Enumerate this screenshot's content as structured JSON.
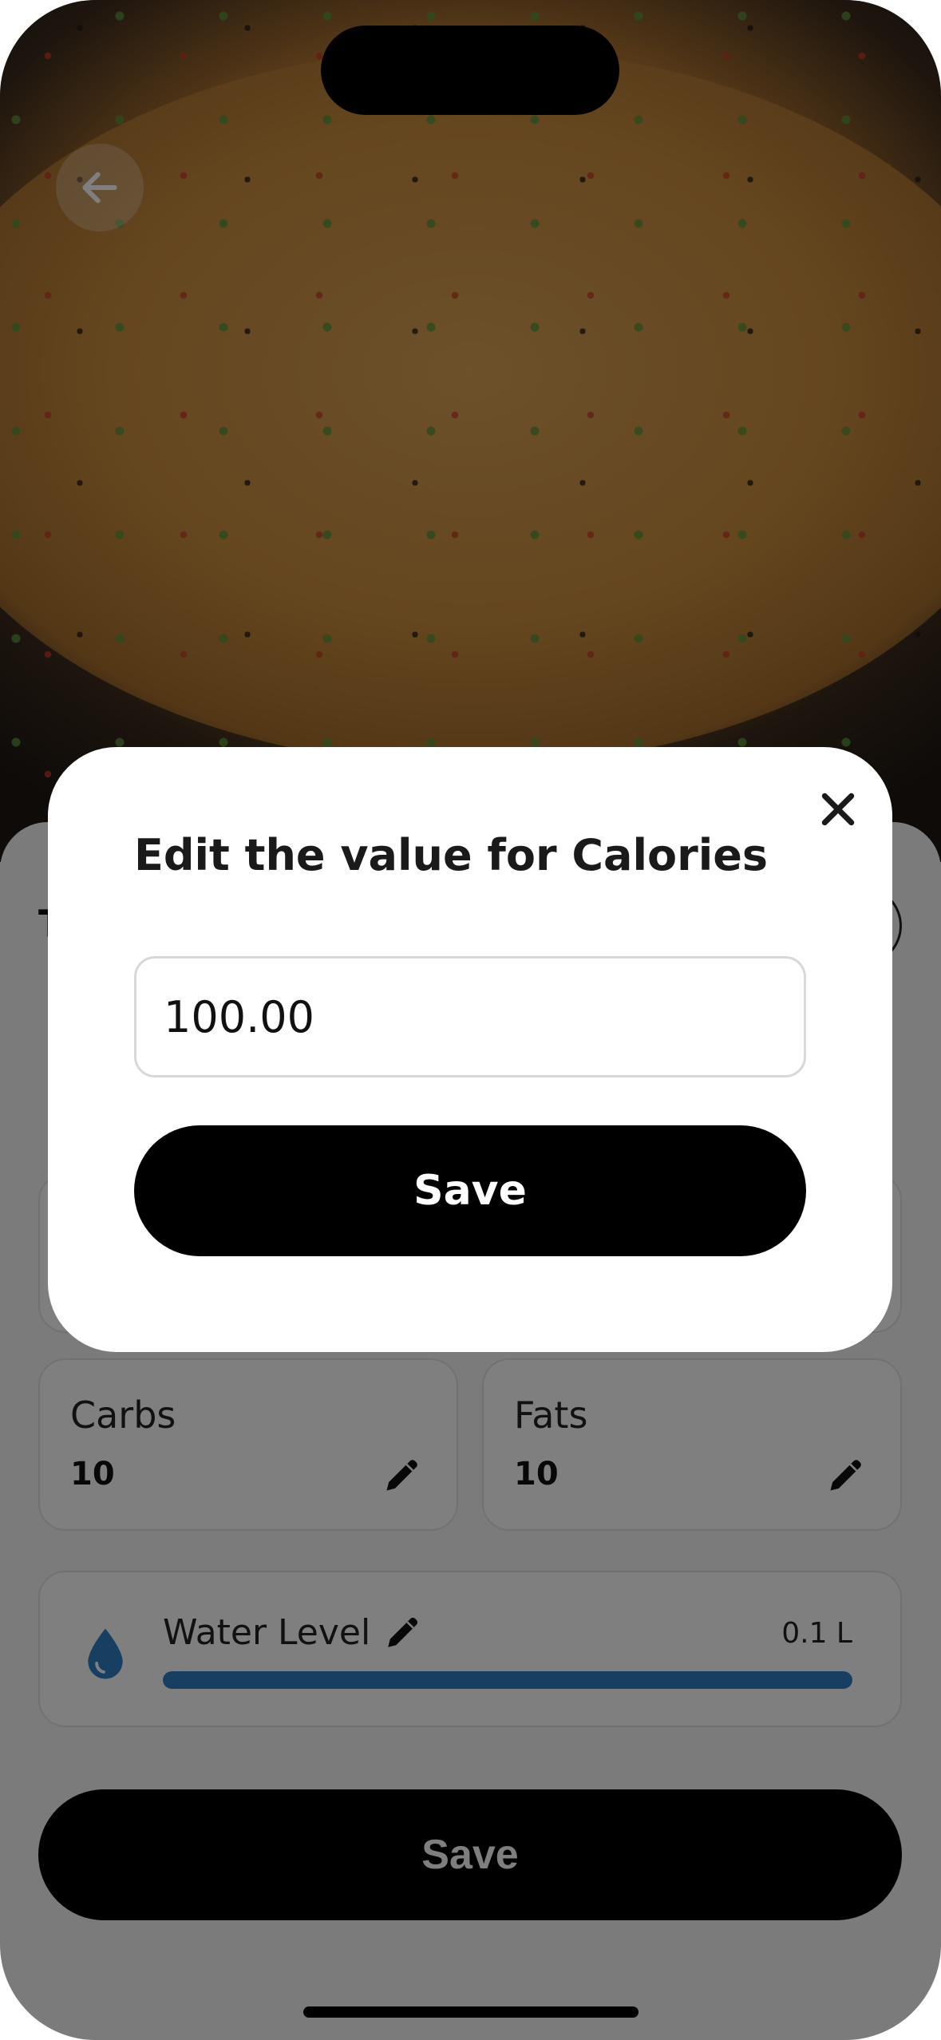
{
  "modal": {
    "title": "Edit the value for Calories",
    "input_value": "100.00",
    "save_label": "Save"
  },
  "nutrients": [
    {
      "label": "Carbs",
      "value": "10"
    },
    {
      "label": "Fats",
      "value": "10"
    }
  ],
  "water": {
    "label": "Water Level",
    "amount": "0.1 L",
    "level_fraction": 1.0
  },
  "footer": {
    "save_label": "Save"
  },
  "colors": {
    "accent_blue": "#2f7fc4",
    "button_black": "#000000"
  },
  "icons": {
    "back": "arrow-left-icon",
    "close": "close-icon",
    "edit": "pencil-icon",
    "water": "water-drop-icon"
  }
}
